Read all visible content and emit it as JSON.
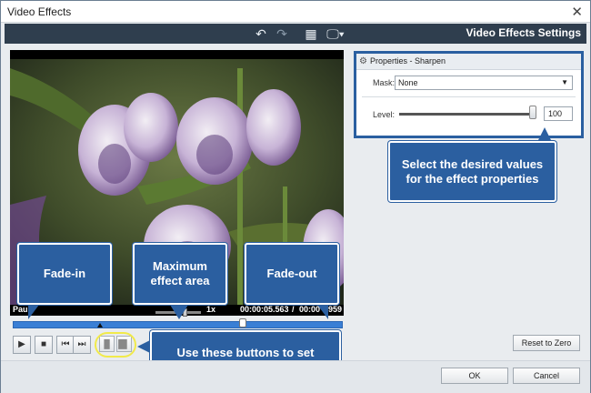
{
  "window": {
    "title": "Video Effects"
  },
  "toolbar": {
    "heading": "Video Effects Settings"
  },
  "player": {
    "speed": "1x",
    "time_current": "00:00:05.563",
    "time_separator": "/",
    "time_total_partial": "00:00",
    "time_tail": "959",
    "status_partial": "Pau",
    "timeline_position": 0.7
  },
  "properties": {
    "header": "Properties - Sharpen",
    "mask_label": "Mask:",
    "mask_value": "None",
    "level_label": "Level:",
    "level_value": "100",
    "level_fraction": 1.0
  },
  "callouts": {
    "effect_props": "Select the desired values for the effect properties",
    "fade_in": "Fade-in",
    "max_area": "Maximum effect area",
    "fade_out": "Fade-out",
    "buttons": "Use these buttons to set fade-in and fade-out areas"
  },
  "buttons": {
    "reset": "Reset to Zero",
    "ok": "OK",
    "cancel": "Cancel"
  },
  "icons": {
    "close": "close-icon",
    "undo": "undo-icon",
    "redo": "redo-icon",
    "grid": "grid-icon",
    "monitor": "monitor-icon",
    "gear": "gear-icon",
    "play": "play-icon",
    "stop": "stop-icon",
    "prev": "previous-frame-icon",
    "next": "next-frame-icon"
  },
  "colors": {
    "accent": "#2b5fa0",
    "toolbar": "#2f3e4e",
    "timeline": "#3a7fd5",
    "highlight": "#f1ea4a"
  }
}
